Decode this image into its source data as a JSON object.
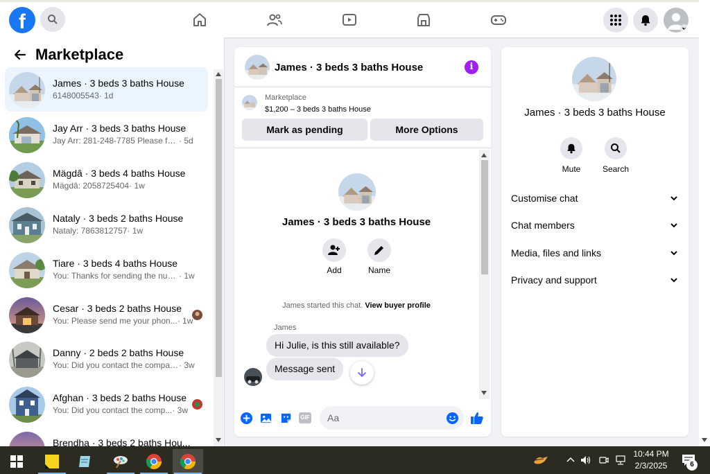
{
  "topbar": {
    "logo": "f",
    "icons": [
      "search-icon",
      "home-icon",
      "friends-icon",
      "watch-icon",
      "marketplace-icon",
      "gaming-icon",
      "menu-grid-icon",
      "notifications-icon",
      "account-avatar"
    ]
  },
  "sidebar": {
    "title": "Marketplace",
    "conversations": [
      {
        "name": "James · 3 beds 3 baths House",
        "snippet": "6148005543",
        "time": "· 1d",
        "active": true
      },
      {
        "name": "Jay Arr · 3 beds 3 baths House",
        "snippet": "Jay Arr: 281-248-7785 Please feel f...",
        "time": "· 5d",
        "active": false
      },
      {
        "name": "Mägdâ · 3 beds 4 baths House",
        "snippet": "Mägdâ: 2058725404",
        "time": "· 1w",
        "active": false
      },
      {
        "name": "Nataly · 3 beds 2 baths House",
        "snippet": "Nataly: 7863812757",
        "time": "· 1w",
        "active": false
      },
      {
        "name": "Tiare · 3 beds 4 baths House",
        "snippet": "You: Thanks for sending the numb...",
        "time": "· 1w",
        "active": false
      },
      {
        "name": "Cesar · 3 beds 2 baths House",
        "snippet": "You: Please send me your phon...",
        "time": "· 1w",
        "active": false
      },
      {
        "name": "Danny · 2 beds 2 baths House",
        "snippet": "You: Did you contact the company...",
        "time": "· 3w",
        "active": false
      },
      {
        "name": "Afghan · 3 beds 2 baths House",
        "snippet": "You: Did you contact the comp...",
        "time": "· 3w",
        "active": false
      },
      {
        "name": "Brendha · 3 beds 2 baths Hou...",
        "snippet": "",
        "time": "",
        "active": false
      }
    ]
  },
  "chat": {
    "title": "James · 3 beds 3 baths House",
    "listing_source": "Marketplace",
    "listing_price": "$1,200 – 3 beds 3 baths House",
    "mark_pending_label": "Mark as pending",
    "more_options_label": "More Options",
    "profile_name": "James · 3 beds 3 baths House",
    "actions": {
      "add": "Add",
      "name": "Name"
    },
    "started_text": "James started this chat.",
    "view_buyer_profile": "View buyer profile",
    "sender": "James",
    "messages": [
      "Hi Julie, is this still available?",
      "Message sent"
    ],
    "input_placeholder": "Aa",
    "gif_label": "GIF"
  },
  "details": {
    "name": "James · 3 beds 3 baths House",
    "mute_label": "Mute",
    "search_label": "Search",
    "sections": [
      "Customise chat",
      "Chat members",
      "Media, files and links",
      "Privacy and support"
    ]
  },
  "taskbar": {
    "time": "10:44 PM",
    "date": "2/3/2025",
    "notification_count": "6"
  },
  "colors": {
    "brand": "#1877f2",
    "info": "#a020f0",
    "active_row": "#ebf5ff",
    "taskbar": "#2b2b22"
  }
}
